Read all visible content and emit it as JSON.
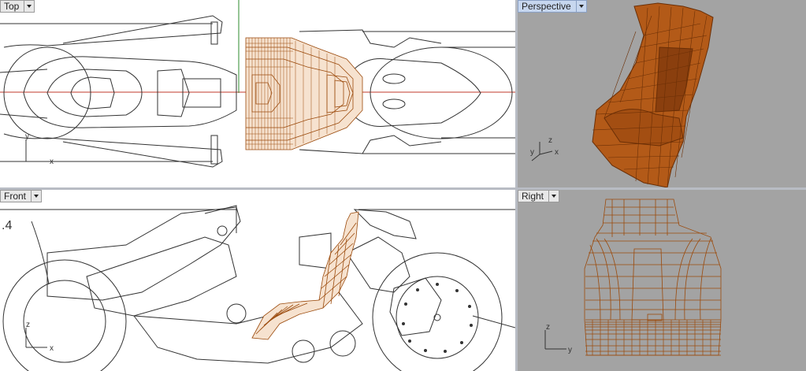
{
  "viewports": {
    "top": {
      "label": "Top",
      "axis_x": "x",
      "axis_y": "y"
    },
    "perspective": {
      "label": "Perspective",
      "axis_x": "x",
      "axis_y": "y",
      "axis_z": "z"
    },
    "front": {
      "label": "Front",
      "axis_x": "x",
      "axis_z": "z",
      "annotation": ".4"
    },
    "right": {
      "label": "Right",
      "axis_y": "y",
      "axis_z": "z"
    }
  },
  "colors": {
    "model": "#9b4a0c",
    "model_fill": "#b9601c",
    "grid_x_axis": "#c0392b",
    "grid_y_axis": "#2e8b2e",
    "active_tab": "#c7d7ef"
  },
  "icons": [
    "chevron-down-icon"
  ]
}
